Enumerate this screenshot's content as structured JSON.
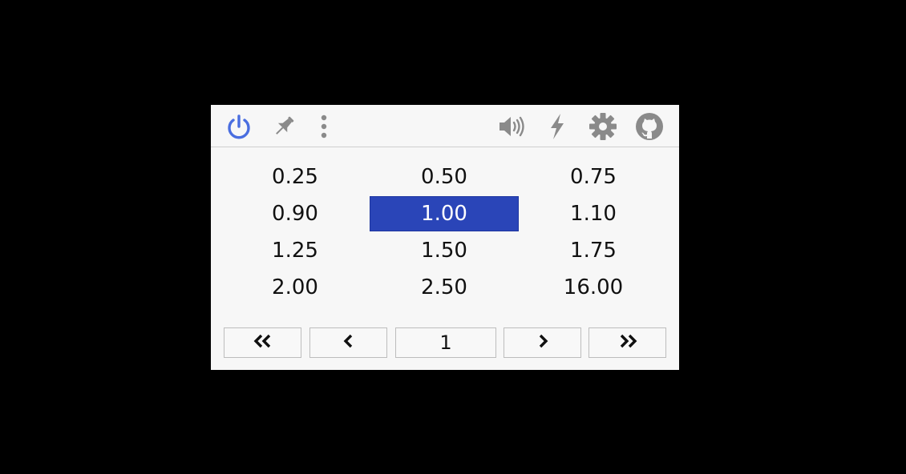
{
  "toolbar": {
    "left_icons": [
      "power-icon",
      "pin-icon",
      "more-vertical-icon"
    ],
    "right_icons": [
      "volume-icon",
      "lightning-icon",
      "gear-icon",
      "github-icon"
    ],
    "accent_color": "#4a6ee0"
  },
  "speeds": [
    "0.25",
    "0.50",
    "0.75",
    "0.90",
    "1.00",
    "1.10",
    "1.25",
    "1.50",
    "1.75",
    "2.00",
    "2.50",
    "16.00"
  ],
  "selected_speed": "1.00",
  "selected_color": "#2a45b8",
  "pager": {
    "first_icon": "double-chevron-left-icon",
    "prev_icon": "chevron-left-icon",
    "page": "1",
    "next_icon": "chevron-right-icon",
    "last_icon": "double-chevron-right-icon"
  }
}
